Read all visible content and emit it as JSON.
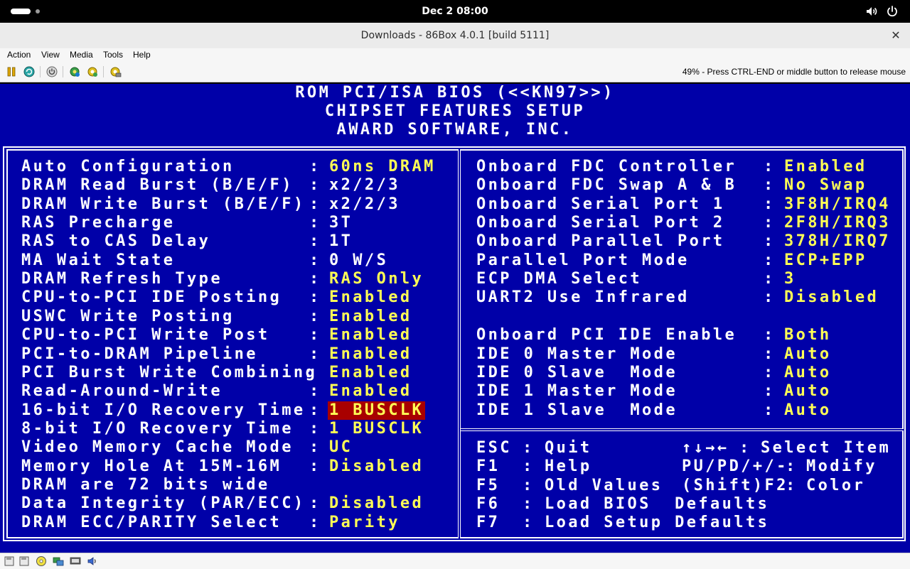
{
  "topbar": {
    "clock": "Dec 2  08:00"
  },
  "window": {
    "title": "Downloads - 86Box 4.0.1 [build 5111]",
    "close_glyph": "✕"
  },
  "menu": [
    "Action",
    "View",
    "Media",
    "Tools",
    "Help"
  ],
  "toolbar": {
    "buttons": [
      "pause-icon",
      "reset-icon",
      "power-icon",
      "settings-icon",
      "settings-alt-icon",
      "hdd-settings-icon"
    ],
    "status": "49% - Press CTRL-END or middle button to release mouse"
  },
  "bios": {
    "header": [
      "ROM PCI/ISA BIOS (<<KN97>>)",
      "CHIPSET FEATURES SETUP",
      "AWARD SOFTWARE, INC."
    ],
    "left": [
      {
        "label": "Auto Configuration",
        "value": "60ns DRAM"
      },
      {
        "label": "DRAM Read Burst (B/E/F)",
        "value": "x2/2/3",
        "white": true
      },
      {
        "label": "DRAM Write Burst (B/E/F)",
        "value": "x2/2/3",
        "white": true
      },
      {
        "label": "RAS Precharge",
        "value": "3T",
        "white": true
      },
      {
        "label": "RAS to CAS Delay",
        "value": "1T",
        "white": true
      },
      {
        "label": "MA Wait State",
        "value": "0 W/S",
        "white": true
      },
      {
        "label": "DRAM Refresh Type",
        "value": "RAS Only"
      },
      {
        "label": "CPU-to-PCI IDE Posting",
        "value": "Enabled"
      },
      {
        "label": "USWC Write Posting",
        "value": "Enabled"
      },
      {
        "label": "CPU-to-PCI Write Post",
        "value": "Enabled"
      },
      {
        "label": "PCI-to-DRAM Pipeline",
        "value": "Enabled"
      },
      {
        "label": "PCI Burst Write Combining",
        "value": "Enabled",
        "tight": true
      },
      {
        "label": "Read-Around-Write",
        "value": "Enabled"
      },
      {
        "label": "16-bit I/O Recovery Time",
        "value": "1 BUSCLK",
        "selected": true
      },
      {
        "label": "8-bit I/O Recovery Time",
        "value": "1 BUSCLK"
      },
      {
        "label": "Video Memory Cache Mode",
        "value": "UC"
      },
      {
        "label": "Memory Hole At 15M-16M",
        "value": "Disabled"
      },
      {
        "label": "DRAM are 72 bits wide",
        "value": null
      },
      {
        "label": "Data Integrity (PAR/ECC)",
        "value": "Disabled"
      },
      {
        "label": "DRAM ECC/PARITY Select",
        "value": "Parity"
      }
    ],
    "right": [
      {
        "label": "Onboard FDC Controller",
        "value": "Enabled"
      },
      {
        "label": "Onboard FDC Swap A & B",
        "value": "No Swap"
      },
      {
        "label": "Onboard Serial Port 1",
        "value": "3F8H/IRQ4"
      },
      {
        "label": "Onboard Serial Port 2",
        "value": "2F8H/IRQ3"
      },
      {
        "label": "Onboard Parallel Port",
        "value": "378H/IRQ7"
      },
      {
        "label": "Parallel Port Mode",
        "value": "ECP+EPP"
      },
      {
        "label": "ECP DMA Select",
        "value": "3"
      },
      {
        "label": "UART2 Use Infrared",
        "value": "Disabled"
      },
      null,
      {
        "label": "Onboard PCI IDE Enable",
        "value": "Both"
      },
      {
        "label": "IDE 0 Master Mode",
        "value": "Auto"
      },
      {
        "label": "IDE 0 Slave  Mode",
        "value": "Auto"
      },
      {
        "label": "IDE 1 Master Mode",
        "value": "Auto"
      },
      {
        "label": "IDE 1 Slave  Mode",
        "value": "Auto"
      }
    ],
    "help": [
      {
        "key": "ESC",
        "action": "Quit",
        "key2": "↑↓→←",
        "action2": "Select Item"
      },
      {
        "key": "F1",
        "action": "Help",
        "key2": "PU/PD/+/-",
        "action2": "Modify"
      },
      {
        "key": "F5",
        "action": "Old Values",
        "key2": "(Shift)F2",
        "action2": "Color"
      },
      {
        "key": "F6",
        "action": "Load BIOS  Defaults"
      },
      {
        "key": "F7",
        "action": "Load Setup Defaults"
      }
    ]
  },
  "statusbar": {
    "icons": [
      "floppy-icon",
      "floppy-2-icon",
      "cdrom-icon",
      "network-icon",
      "display-icon",
      "sound-icon"
    ]
  },
  "colors": {
    "bios_bg": "#0000a8",
    "bios_value": "#ffff55",
    "bios_highlight": "#a80000"
  }
}
